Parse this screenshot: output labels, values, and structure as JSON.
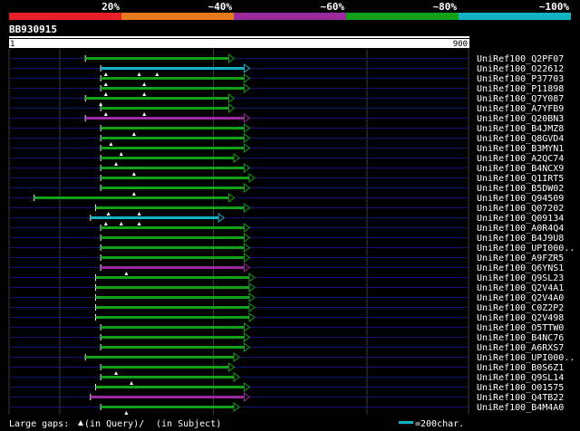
{
  "query_id": "BB930915",
  "scale": {
    "start": "1",
    "end": "900",
    "min": 1,
    "max": 900
  },
  "legend": {
    "bands": [
      {
        "label": "20%",
        "color": "#e8202a"
      },
      {
        "label": "~40%",
        "color": "#e87a1e"
      },
      {
        "label": "~60%",
        "color": "#9a2a9e"
      },
      {
        "label": "~80%",
        "color": "#14a019"
      },
      {
        "label": "~100%",
        "color": "#12b2c4"
      }
    ],
    "gap_note_a": "Large gaps:",
    "gap_note_b": "(in Query)/",
    "gap_note_c": "(in Subject)",
    "scale_note": "=200char."
  },
  "colors": {
    "background": "#000000",
    "row_line": "#14146e",
    "green": "#14a019",
    "cyan": "#12b2c4",
    "purple": "#9a2a9e",
    "guide": "#3c3c3c"
  },
  "chart_data": {
    "type": "alignment",
    "x_range": [
      1,
      900
    ],
    "rows": [
      {
        "name": "UniRef100_Q2PF07",
        "start": 150,
        "end": 430,
        "color": "green"
      },
      {
        "name": "UniRef100_O22612",
        "start": 180,
        "end": 460,
        "color": "cyan",
        "marks": [
          190,
          255,
          290
        ]
      },
      {
        "name": "UniRef100_P37703",
        "start": 180,
        "end": 460,
        "color": "green",
        "marks": [
          190,
          265
        ]
      },
      {
        "name": "UniRef100_P11898",
        "start": 180,
        "end": 460,
        "color": "green",
        "marks": [
          190,
          265
        ]
      },
      {
        "name": "UniRef100_Q7Y087",
        "start": 150,
        "end": 430,
        "color": "green",
        "marks": [
          180
        ]
      },
      {
        "name": "UniRef100_A7YFB9",
        "start": 180,
        "end": 430,
        "color": "green",
        "marks": [
          190,
          265
        ]
      },
      {
        "name": "UniRef100_Q20BN3",
        "start": 150,
        "end": 460,
        "color": "purple"
      },
      {
        "name": "UniRef100_B4JMZ8",
        "start": 180,
        "end": 460,
        "color": "green",
        "marks": [
          245
        ]
      },
      {
        "name": "UniRef100_Q8GVD4",
        "start": 180,
        "end": 460,
        "color": "green",
        "marks": [
          200
        ]
      },
      {
        "name": "UniRef100_B3MYN1",
        "start": 180,
        "end": 460,
        "color": "green",
        "marks": [
          220
        ]
      },
      {
        "name": "UniRef100_A2QC74",
        "start": 180,
        "end": 440,
        "color": "green",
        "marks": [
          210
        ]
      },
      {
        "name": "UniRef100_B4NCX9",
        "start": 180,
        "end": 460,
        "color": "green",
        "marks": [
          245
        ]
      },
      {
        "name": "UniRef100_Q1IRT5",
        "start": 180,
        "end": 470,
        "color": "green"
      },
      {
        "name": "UniRef100_B5DW02",
        "start": 180,
        "end": 460,
        "color": "green",
        "marks": [
          245
        ]
      },
      {
        "name": "UniRef100_Q94509",
        "start": 50,
        "end": 430,
        "color": "green"
      },
      {
        "name": "UniRef100_Q07202",
        "start": 170,
        "end": 460,
        "color": "green",
        "marks": [
          195,
          255
        ]
      },
      {
        "name": "UniRef100_Q09134",
        "start": 160,
        "end": 410,
        "color": "cyan",
        "marks": [
          190,
          220,
          255
        ]
      },
      {
        "name": "UniRef100_A0R4Q4",
        "start": 180,
        "end": 460,
        "color": "green"
      },
      {
        "name": "UniRef100_B4J9U8",
        "start": 180,
        "end": 460,
        "color": "green"
      },
      {
        "name": "UniRef100_UPI000..",
        "start": 180,
        "end": 460,
        "color": "green"
      },
      {
        "name": "UniRef100_A9FZR5",
        "start": 180,
        "end": 460,
        "color": "green"
      },
      {
        "name": "UniRef100_Q6YNS1",
        "start": 180,
        "end": 460,
        "color": "purple",
        "marks": [
          230
        ]
      },
      {
        "name": "UniRef100_Q9SL23",
        "start": 170,
        "end": 470,
        "color": "green"
      },
      {
        "name": "UniRef100_Q2V4A1",
        "start": 170,
        "end": 470,
        "color": "green"
      },
      {
        "name": "UniRef100_Q2V4A0",
        "start": 170,
        "end": 470,
        "color": "green"
      },
      {
        "name": "UniRef100_C0Z2P2",
        "start": 170,
        "end": 470,
        "color": "green"
      },
      {
        "name": "UniRef100_Q2V498",
        "start": 170,
        "end": 470,
        "color": "green"
      },
      {
        "name": "UniRef100_O5TTW0",
        "start": 180,
        "end": 460,
        "color": "green"
      },
      {
        "name": "UniRef100_B4NC76",
        "start": 180,
        "end": 460,
        "color": "green"
      },
      {
        "name": "UniRef100_A6RXS7",
        "start": 180,
        "end": 460,
        "color": "green"
      },
      {
        "name": "UniRef100_UPI000..",
        "start": 150,
        "end": 440,
        "color": "green"
      },
      {
        "name": "UniRef100_B0S6Z1",
        "start": 180,
        "end": 430,
        "color": "green",
        "marks": [
          210
        ]
      },
      {
        "name": "UniRef100_Q9SL14",
        "start": 180,
        "end": 440,
        "color": "green",
        "marks": [
          240
        ]
      },
      {
        "name": "UniRef100_O01575",
        "start": 170,
        "end": 460,
        "color": "green"
      },
      {
        "name": "UniRef100_Q4TB22",
        "start": 160,
        "end": 460,
        "color": "purple"
      },
      {
        "name": "UniRef100_B4M4A0",
        "start": 180,
        "end": 440,
        "color": "green",
        "marks": [
          230
        ]
      }
    ]
  }
}
